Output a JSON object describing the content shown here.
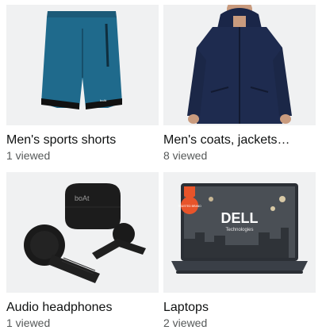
{
  "products": [
    {
      "title": "Men's sports shorts",
      "subtitle": "1 viewed",
      "icon": "sports-shorts",
      "colors": {
        "fabric": "#1f6a8c",
        "band": "#1a1a1a"
      }
    },
    {
      "title": "Men's coats, jackets…",
      "subtitle": "8 viewed",
      "icon": "hooded-jacket",
      "colors": {
        "fabric": "#1e2b4f",
        "skin": "#c99b7e"
      }
    },
    {
      "title": "Audio headphones",
      "subtitle": "1 viewed",
      "icon": "wireless-earbuds",
      "colors": {
        "body": "#1c1c1c"
      },
      "brand_text": "boAt"
    },
    {
      "title": "Laptops",
      "subtitle": "2 viewed",
      "icon": "laptop",
      "colors": {
        "chassis": "#3a3f47",
        "badge": "#e8542a"
      },
      "brand_text": "DELL",
      "brand_sub": "Technologies",
      "badge_text": "TRUSTED BRAND"
    }
  ]
}
